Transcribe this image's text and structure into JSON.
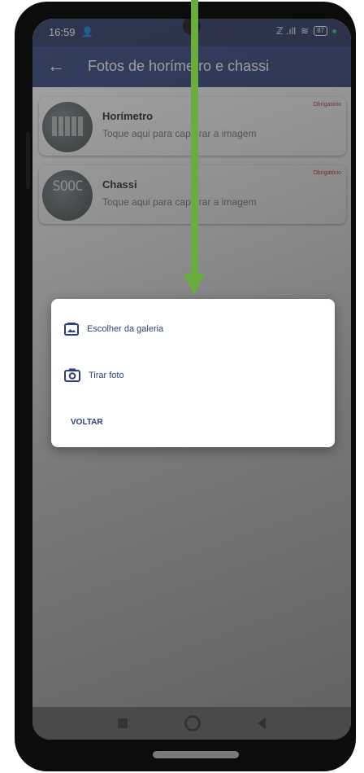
{
  "status_bar": {
    "time": "16:59",
    "person_icon": "person-location-icon",
    "signal_text": "ℤ .ıll",
    "wifi_icon": "wifi-icon",
    "battery": "87"
  },
  "app_bar": {
    "back_icon": "back-arrow-icon",
    "title": "Fotos de horímetro e chassi"
  },
  "cards": [
    {
      "title": "Horímetro",
      "subtitle": "Toque aqui para capturar a imagem",
      "required": "Obrigatório",
      "thumb_text": "3.1.8"
    },
    {
      "title": "Chassi",
      "subtitle": "Toque aqui para capturar a imagem",
      "required": "Obrigatório",
      "thumb_text": "SOOC"
    }
  ],
  "dialog": {
    "gallery_label": "Escolher da galeria",
    "camera_label": "Tirar foto",
    "cancel_label": "VOLTAR"
  },
  "colors": {
    "primary": "#2d3f7a",
    "annotation_arrow": "#6aad3e",
    "required": "#c62828"
  }
}
